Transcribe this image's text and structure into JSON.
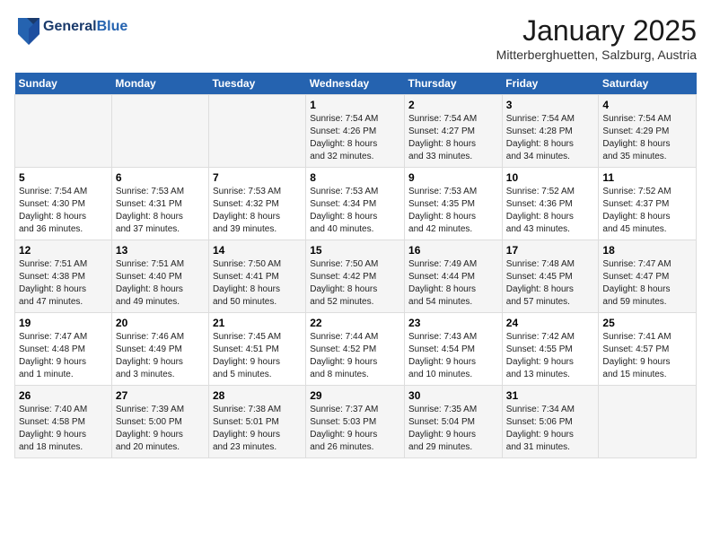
{
  "header": {
    "logo_line1": "General",
    "logo_line2": "Blue",
    "month": "January 2025",
    "location": "Mitterberghuetten, Salzburg, Austria"
  },
  "days_of_week": [
    "Sunday",
    "Monday",
    "Tuesday",
    "Wednesday",
    "Thursday",
    "Friday",
    "Saturday"
  ],
  "weeks": [
    [
      {
        "day": "",
        "info": ""
      },
      {
        "day": "",
        "info": ""
      },
      {
        "day": "",
        "info": ""
      },
      {
        "day": "1",
        "info": "Sunrise: 7:54 AM\nSunset: 4:26 PM\nDaylight: 8 hours\nand 32 minutes."
      },
      {
        "day": "2",
        "info": "Sunrise: 7:54 AM\nSunset: 4:27 PM\nDaylight: 8 hours\nand 33 minutes."
      },
      {
        "day": "3",
        "info": "Sunrise: 7:54 AM\nSunset: 4:28 PM\nDaylight: 8 hours\nand 34 minutes."
      },
      {
        "day": "4",
        "info": "Sunrise: 7:54 AM\nSunset: 4:29 PM\nDaylight: 8 hours\nand 35 minutes."
      }
    ],
    [
      {
        "day": "5",
        "info": "Sunrise: 7:54 AM\nSunset: 4:30 PM\nDaylight: 8 hours\nand 36 minutes."
      },
      {
        "day": "6",
        "info": "Sunrise: 7:53 AM\nSunset: 4:31 PM\nDaylight: 8 hours\nand 37 minutes."
      },
      {
        "day": "7",
        "info": "Sunrise: 7:53 AM\nSunset: 4:32 PM\nDaylight: 8 hours\nand 39 minutes."
      },
      {
        "day": "8",
        "info": "Sunrise: 7:53 AM\nSunset: 4:34 PM\nDaylight: 8 hours\nand 40 minutes."
      },
      {
        "day": "9",
        "info": "Sunrise: 7:53 AM\nSunset: 4:35 PM\nDaylight: 8 hours\nand 42 minutes."
      },
      {
        "day": "10",
        "info": "Sunrise: 7:52 AM\nSunset: 4:36 PM\nDaylight: 8 hours\nand 43 minutes."
      },
      {
        "day": "11",
        "info": "Sunrise: 7:52 AM\nSunset: 4:37 PM\nDaylight: 8 hours\nand 45 minutes."
      }
    ],
    [
      {
        "day": "12",
        "info": "Sunrise: 7:51 AM\nSunset: 4:38 PM\nDaylight: 8 hours\nand 47 minutes."
      },
      {
        "day": "13",
        "info": "Sunrise: 7:51 AM\nSunset: 4:40 PM\nDaylight: 8 hours\nand 49 minutes."
      },
      {
        "day": "14",
        "info": "Sunrise: 7:50 AM\nSunset: 4:41 PM\nDaylight: 8 hours\nand 50 minutes."
      },
      {
        "day": "15",
        "info": "Sunrise: 7:50 AM\nSunset: 4:42 PM\nDaylight: 8 hours\nand 52 minutes."
      },
      {
        "day": "16",
        "info": "Sunrise: 7:49 AM\nSunset: 4:44 PM\nDaylight: 8 hours\nand 54 minutes."
      },
      {
        "day": "17",
        "info": "Sunrise: 7:48 AM\nSunset: 4:45 PM\nDaylight: 8 hours\nand 57 minutes."
      },
      {
        "day": "18",
        "info": "Sunrise: 7:47 AM\nSunset: 4:47 PM\nDaylight: 8 hours\nand 59 minutes."
      }
    ],
    [
      {
        "day": "19",
        "info": "Sunrise: 7:47 AM\nSunset: 4:48 PM\nDaylight: 9 hours\nand 1 minute."
      },
      {
        "day": "20",
        "info": "Sunrise: 7:46 AM\nSunset: 4:49 PM\nDaylight: 9 hours\nand 3 minutes."
      },
      {
        "day": "21",
        "info": "Sunrise: 7:45 AM\nSunset: 4:51 PM\nDaylight: 9 hours\nand 5 minutes."
      },
      {
        "day": "22",
        "info": "Sunrise: 7:44 AM\nSunset: 4:52 PM\nDaylight: 9 hours\nand 8 minutes."
      },
      {
        "day": "23",
        "info": "Sunrise: 7:43 AM\nSunset: 4:54 PM\nDaylight: 9 hours\nand 10 minutes."
      },
      {
        "day": "24",
        "info": "Sunrise: 7:42 AM\nSunset: 4:55 PM\nDaylight: 9 hours\nand 13 minutes."
      },
      {
        "day": "25",
        "info": "Sunrise: 7:41 AM\nSunset: 4:57 PM\nDaylight: 9 hours\nand 15 minutes."
      }
    ],
    [
      {
        "day": "26",
        "info": "Sunrise: 7:40 AM\nSunset: 4:58 PM\nDaylight: 9 hours\nand 18 minutes."
      },
      {
        "day": "27",
        "info": "Sunrise: 7:39 AM\nSunset: 5:00 PM\nDaylight: 9 hours\nand 20 minutes."
      },
      {
        "day": "28",
        "info": "Sunrise: 7:38 AM\nSunset: 5:01 PM\nDaylight: 9 hours\nand 23 minutes."
      },
      {
        "day": "29",
        "info": "Sunrise: 7:37 AM\nSunset: 5:03 PM\nDaylight: 9 hours\nand 26 minutes."
      },
      {
        "day": "30",
        "info": "Sunrise: 7:35 AM\nSunset: 5:04 PM\nDaylight: 9 hours\nand 29 minutes."
      },
      {
        "day": "31",
        "info": "Sunrise: 7:34 AM\nSunset: 5:06 PM\nDaylight: 9 hours\nand 31 minutes."
      },
      {
        "day": "",
        "info": ""
      }
    ]
  ]
}
